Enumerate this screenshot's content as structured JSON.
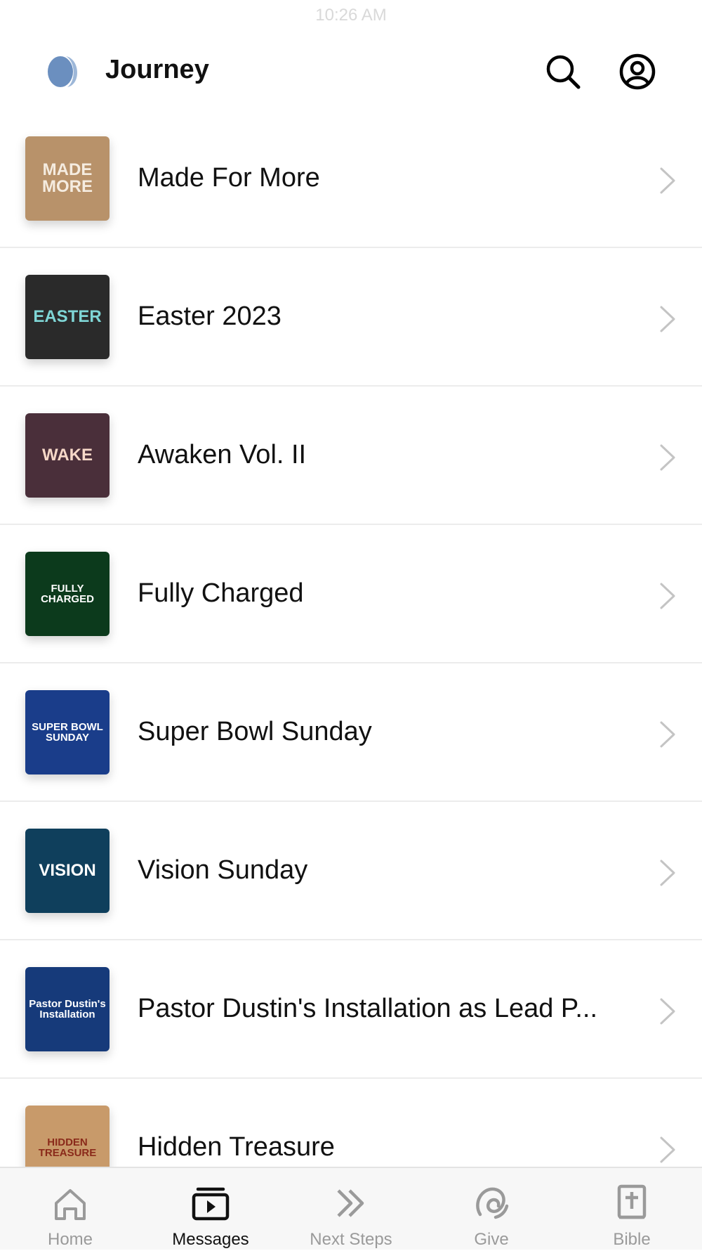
{
  "status": {
    "time": "10:26 AM"
  },
  "header": {
    "title": "Journey",
    "logo_color": "#6b8fbf"
  },
  "series": [
    {
      "title": "Made For More",
      "art_text": "MADE MORE",
      "art_bg": "#b8926a",
      "art_fg": "#f5ece0"
    },
    {
      "title": "Easter 2023",
      "art_text": "EASTER",
      "art_bg": "#2a2a2a",
      "art_fg": "#7fd6d6"
    },
    {
      "title": "Awaken Vol. II",
      "art_text": "WAKE",
      "art_bg": "#4a2f3a",
      "art_fg": "#f6d8c8"
    },
    {
      "title": "Fully Charged",
      "art_text": "FULLY CHARGED",
      "art_bg": "#0c3a1c",
      "art_fg": "#ffffff"
    },
    {
      "title": "Super Bowl Sunday",
      "art_text": "SUPER BOWL SUNDAY",
      "art_bg": "#1a3d8a",
      "art_fg": "#ffffff"
    },
    {
      "title": "Vision Sunday",
      "art_text": "VISION",
      "art_bg": "#0f3f5c",
      "art_fg": "#ffffff"
    },
    {
      "title": "Pastor Dustin's Installation as Lead P...",
      "art_text": "Pastor Dustin's Installation",
      "art_bg": "#163a7a",
      "art_fg": "#ffffff"
    },
    {
      "title": "Hidden Treasure",
      "art_text": "HIDDEN TREASURE",
      "art_bg": "#c89a6a",
      "art_fg": "#8a2a1a"
    }
  ],
  "tabs": [
    {
      "label": "Home",
      "icon": "home-icon",
      "active": false
    },
    {
      "label": "Messages",
      "icon": "messages-icon",
      "active": true
    },
    {
      "label": "Next Steps",
      "icon": "next-steps-icon",
      "active": false
    },
    {
      "label": "Give",
      "icon": "give-icon",
      "active": false
    },
    {
      "label": "Bible",
      "icon": "bible-icon",
      "active": false
    }
  ]
}
